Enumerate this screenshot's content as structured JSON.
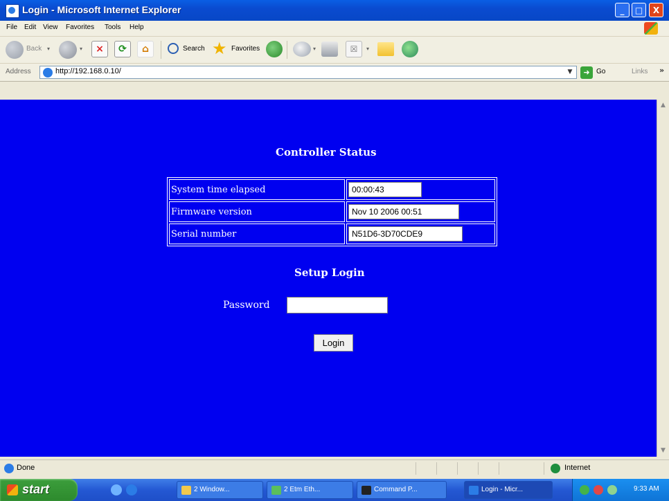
{
  "window": {
    "title": "Login - Microsoft Internet Explorer",
    "minimize": "_",
    "maximize": "□",
    "close": "X"
  },
  "menu": [
    "File",
    "Edit",
    "View",
    "Favorites",
    "Tools",
    "Help"
  ],
  "toolbar": {
    "back_label": "Back",
    "search_label": "Search",
    "favorites_label": "Favorites"
  },
  "address": {
    "label": "Address",
    "url": "http://192.168.0.10/",
    "go_label": "Go",
    "links_label": "Links",
    "links_chevron": "»"
  },
  "page": {
    "status_heading": "Controller Status",
    "rows": [
      {
        "label": "System time elapsed",
        "value": "00:00:43"
      },
      {
        "label": "Firmware version",
        "value": "Nov 10 2006 00:51"
      },
      {
        "label": "Serial number",
        "value": "N51D6-3D70CDE9"
      }
    ],
    "login_heading": "Setup Login",
    "password_label": "Password",
    "login_button": "Login"
  },
  "statusbar": {
    "status": "Done",
    "zone": "Internet"
  },
  "taskbar": {
    "start_label": "start",
    "tasks": [
      {
        "label": "2 Window...",
        "icon": "folder-icon",
        "color": "#f2c94c"
      },
      {
        "label": "2 Etm Eth...",
        "icon": "app-icon",
        "color": "#5bbf5b"
      },
      {
        "label": "Command P...",
        "icon": "console-icon",
        "color": "#222222"
      },
      {
        "label": "Login - Micr...",
        "icon": "ie-icon",
        "color": "#2b7ce6"
      }
    ],
    "clock": "9:33 AM"
  },
  "colors": {
    "page_background": "#0000f0",
    "titlebar": "#0a4bd0",
    "taskbar": "#2458d3",
    "start_button": "#2d8a2d"
  }
}
